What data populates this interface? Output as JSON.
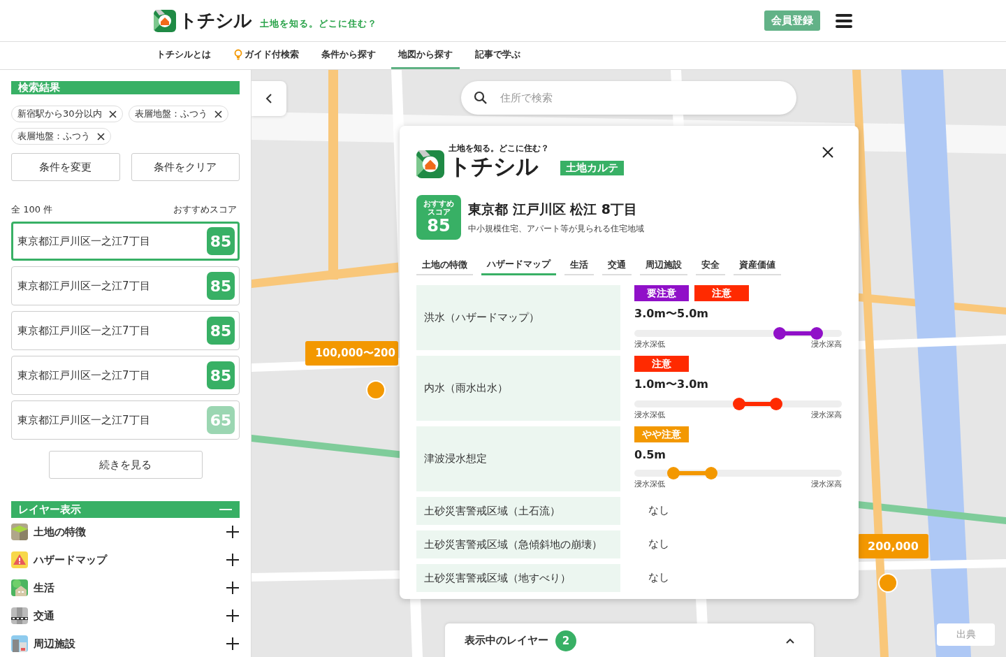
{
  "header": {
    "logo_text": "トチシル",
    "tagline": "土地を知る。どこに住む？",
    "register_button": "会員登録"
  },
  "nav": [
    {
      "label": "トチシルとは",
      "kind": "plain",
      "selected": false
    },
    {
      "label": "ガイド付検索",
      "kind": "bulb",
      "selected": false
    },
    {
      "label": "条件から探す",
      "kind": "plain",
      "selected": false
    },
    {
      "label": "地図から探す",
      "kind": "plain",
      "selected": true
    },
    {
      "label": "記事で学ぶ",
      "kind": "plain",
      "selected": false
    }
  ],
  "sidebar": {
    "results_title": "検索結果",
    "chips": [
      "新宿駅から30分以内",
      "表層地盤：ふつう",
      "表層地盤：ふつう"
    ],
    "buttons": [
      "条件を変更",
      "条件をクリア"
    ],
    "count": "全 100 件",
    "sort_label": "おすすめスコア",
    "results": [
      {
        "address": "東京都江戸川区一之江7丁目",
        "score": "85",
        "color": "#38b065",
        "selected": true
      },
      {
        "address": "東京都江戸川区一之江7丁目",
        "score": "85",
        "color": "#38b065",
        "selected": false
      },
      {
        "address": "東京都江戸川区一之江7丁目",
        "score": "85",
        "color": "#38b065",
        "selected": false
      },
      {
        "address": "東京都江戸川区一之江7丁目",
        "score": "85",
        "color": "#38b065",
        "selected": false
      },
      {
        "address": "東京都江戸川区一之江7丁目",
        "score": "65",
        "color": "#9bd6b2",
        "selected": false
      }
    ],
    "more_button": "続きを見る",
    "layers": {
      "title": "レイヤー表示",
      "expanded": true,
      "items": [
        {
          "label": "土地の特徴",
          "kind": "land"
        },
        {
          "label": "ハザードマップ",
          "kind": "hazard"
        },
        {
          "label": "生活",
          "kind": "life"
        },
        {
          "label": "交通",
          "kind": "traffic"
        },
        {
          "label": "周辺施設",
          "kind": "facility"
        }
      ]
    }
  },
  "map": {
    "search": {
      "placeholder": "住所で検索"
    },
    "price_pins": [
      {
        "label": "100,000〜200"
      },
      {
        "label": "200,000"
      }
    ],
    "source_button": "出典",
    "layer_bar": {
      "label": "表示中のレイヤー",
      "count": "2"
    }
  },
  "card": {
    "tagline": "土地を知る。どこに住む？",
    "logo_text": "トチシル",
    "badge": "土地カルテ",
    "score_label": "おすすめスコア",
    "score": "85",
    "address": "東京都 江戸川区 松江 8丁目",
    "description": "中小規模住宅、アパート等が見られる住宅地域",
    "tabs": [
      {
        "label": "土地の特徴",
        "selected": false
      },
      {
        "label": "ハザードマップ",
        "selected": true
      },
      {
        "label": "生活",
        "selected": false
      },
      {
        "label": "交通",
        "selected": false
      },
      {
        "label": "周辺施設",
        "selected": false
      },
      {
        "label": "安全",
        "selected": false
      },
      {
        "label": "資産価値",
        "selected": false
      }
    ],
    "hazards": [
      {
        "label": "洪水（ハザードマップ）",
        "kind": "range",
        "tags": [
          {
            "label": "要注意",
            "color": "#9010c8"
          },
          {
            "label": "注意",
            "color": "#ff2a00"
          }
        ],
        "value": "3.0m〜5.0m",
        "color": "#9010c8",
        "thumbs": [
          {
            "level": 0.7
          },
          {
            "level": 0.88
          }
        ],
        "low_label": "浸水深低",
        "high_label": "浸水深高"
      },
      {
        "label": "内水（雨水出水）",
        "kind": "range",
        "tags": [
          {
            "label": "注意",
            "color": "#ff2a00"
          }
        ],
        "value": "1.0m〜3.0m",
        "color": "#ff2a00",
        "thumbs": [
          {
            "level": 0.505
          },
          {
            "level": 0.683
          }
        ],
        "low_label": "浸水深低",
        "high_label": "浸水深高"
      },
      {
        "label": "津波浸水想定",
        "kind": "range",
        "tags": [
          {
            "label": "やや注意",
            "color": "#f39800"
          }
        ],
        "value": "0.5m",
        "color": "#f39800",
        "thumbs": [
          {
            "level": 0.19
          },
          {
            "level": 0.37
          }
        ],
        "low_label": "浸水深低",
        "high_label": "浸水深高"
      },
      {
        "label": "土砂災害警戒区域（土石流）",
        "kind": "none",
        "value": "なし"
      },
      {
        "label": "土砂災害警戒区域（急傾斜地の崩壊）",
        "kind": "none",
        "value": "なし"
      },
      {
        "label": "土砂災害警戒区域（地すべり）",
        "kind": "none",
        "value": "なし"
      }
    ]
  }
}
